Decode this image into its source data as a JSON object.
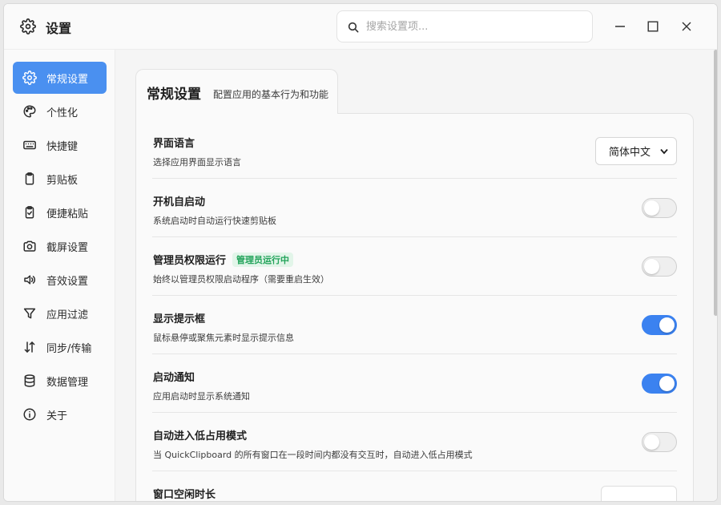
{
  "window": {
    "title": "设置",
    "search_placeholder": "搜索设置项..."
  },
  "sidebar": {
    "items": [
      {
        "label": "常规设置",
        "icon": "gear-icon",
        "active": true
      },
      {
        "label": "个性化",
        "icon": "palette-icon"
      },
      {
        "label": "快捷键",
        "icon": "keyboard-icon"
      },
      {
        "label": "剪贴板",
        "icon": "clipboard-icon"
      },
      {
        "label": "便捷粘贴",
        "icon": "clipboard-check-icon"
      },
      {
        "label": "截屏设置",
        "icon": "camera-icon"
      },
      {
        "label": "音效设置",
        "icon": "speaker-icon"
      },
      {
        "label": "应用过滤",
        "icon": "filter-icon"
      },
      {
        "label": "同步/传输",
        "icon": "sync-arrows-icon"
      },
      {
        "label": "数据管理",
        "icon": "database-icon"
      },
      {
        "label": "关于",
        "icon": "info-icon"
      }
    ]
  },
  "tab": {
    "title": "常规设置",
    "subtitle": "配置应用的基本行为和功能"
  },
  "settings": [
    {
      "title": "界面语言",
      "desc": "选择应用界面显示语言",
      "control": "select",
      "value": "简体中文"
    },
    {
      "title": "开机自启动",
      "desc": "系统启动时自动运行快速剪贴板",
      "control": "toggle",
      "on": false
    },
    {
      "title": "管理员权限运行",
      "badge": "管理员运行中",
      "desc": "始终以管理员权限启动程序（需要重启生效）",
      "control": "toggle",
      "on": false
    },
    {
      "title": "显示提示框",
      "desc": "鼠标悬停或聚焦元素时显示提示信息",
      "control": "toggle",
      "on": true
    },
    {
      "title": "启动通知",
      "desc": "应用启动时显示系统通知",
      "control": "toggle",
      "on": true
    },
    {
      "title": "自动进入低占用模式",
      "desc": "当 QuickClipboard 的所有窗口在一段时间内都没有交互时，自动进入低占用模式",
      "control": "toggle",
      "on": false
    },
    {
      "title": "窗口空闲时长",
      "control": "input"
    }
  ],
  "colors": {
    "accent": "#4a90f0",
    "toggle_on": "#3b82f0",
    "badge_text": "#22a35a",
    "badge_bg": "#e2f5e9"
  }
}
